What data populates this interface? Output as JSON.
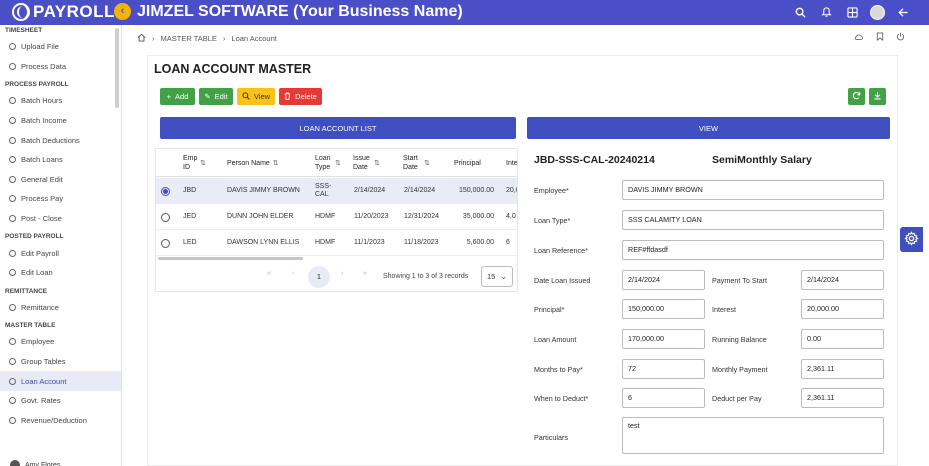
{
  "header": {
    "brand": "PAYROLL",
    "app_title": "JIMZEL SOFTWARE (Your Business Name)",
    "collapse_icon": "chevron-left-icon",
    "bg_color": "#4a4fc8"
  },
  "sidebar": {
    "sections": [
      {
        "label": "TIMESHEET",
        "items": [
          {
            "label": "Upload File"
          },
          {
            "label": "Process Data"
          }
        ]
      },
      {
        "label": "PROCESS PAYROLL",
        "items": [
          {
            "label": "Batch Hours"
          },
          {
            "label": "Batch Income"
          },
          {
            "label": "Batch Deductions"
          },
          {
            "label": "Batch Loans"
          },
          {
            "label": "General Edit"
          },
          {
            "label": "Process Pay"
          },
          {
            "label": "Post - Close"
          }
        ]
      },
      {
        "label": "POSTED PAYROLL",
        "items": [
          {
            "label": "Edit Payroll"
          },
          {
            "label": "Edit Loan"
          }
        ]
      },
      {
        "label": "REMITTANCE",
        "items": [
          {
            "label": "Remittance"
          }
        ]
      },
      {
        "label": "MASTER TABLE",
        "items": [
          {
            "label": "Employee"
          },
          {
            "label": "Group Tables"
          },
          {
            "label": "Loan Account"
          },
          {
            "label": "Govt. Rates"
          },
          {
            "label": "Revenue/Deduction"
          }
        ]
      }
    ],
    "active_item": "Loan Account",
    "user": "Amy Flores"
  },
  "breadcrumb": {
    "items": [
      "MASTER TABLE",
      "Loan Account"
    ]
  },
  "page_title": "LOAN ACCOUNT MASTER",
  "toolbar": {
    "add": "Add",
    "edit": "Edit",
    "view": "View",
    "delete": "Delete"
  },
  "list_bar": "LOAN ACCOUNT LIST",
  "view_bar": "VIEW",
  "table": {
    "columns": [
      "Emp ID",
      "Person Name",
      "Loan Type",
      "Issue Date",
      "Start Date",
      "Principal",
      "Inte"
    ],
    "rows": [
      {
        "selected": true,
        "emp_id": "JBD",
        "name": "DAVIS JIMMY BROWN",
        "loan_type": "SSS-CAL",
        "issue": "2/14/2024",
        "start": "2/14/2024",
        "principal": "150,000.00",
        "interest": "20,0"
      },
      {
        "selected": false,
        "emp_id": "JED",
        "name": "DUNN JOHN ELDER",
        "loan_type": "HDMF",
        "issue": "11/20/2023",
        "start": "12/31/2024",
        "principal": "35,000.00",
        "interest": "4,0"
      },
      {
        "selected": false,
        "emp_id": "LED",
        "name": "DAWSON LYNN ELLIS",
        "loan_type": "HDMF",
        "issue": "11/1/2023",
        "start": "11/18/2023",
        "principal": "5,600.00",
        "interest": "6"
      }
    ],
    "pager": {
      "first": "«",
      "prev": "‹",
      "page": "1",
      "next": "›",
      "last": "»",
      "info": "Showing 1 to 3 of 3 records",
      "page_size": "15"
    }
  },
  "form": {
    "title": "JBD-SSS-CAL-20240214",
    "subtitle": "SemiMonthly Salary",
    "employee_label": "Employee*",
    "employee": "DAVIS JIMMY BROWN",
    "loan_type_label": "Loan Type*",
    "loan_type": "SSS CALAMITY LOAN",
    "loan_ref_label": "Loan Reference*",
    "loan_ref": "REF#ffdasdf",
    "date_issued_label": "Date Loan Issued",
    "date_issued": "2/14/2024",
    "payment_start_label": "Payment To Start",
    "payment_start": "2/14/2024",
    "principal_label": "Principal*",
    "principal": "150,000.00",
    "interest_label": "Interest",
    "interest": "20,000.00",
    "loan_amount_label": "Loan Amount",
    "loan_amount": "170,000.00",
    "running_balance_label": "Running Balance",
    "running_balance": "0.00",
    "months_label": "Months to Pay*",
    "months": "72",
    "monthly_payment_label": "Monthly Payment",
    "monthly_payment": "2,361.11",
    "when_deduct_label": "When to Deduct*",
    "when_deduct": "6",
    "deduct_per_pay_label": "Deduct per Pay",
    "deduct_per_pay": "2,361.11",
    "particulars_label": "Particulars",
    "particulars": "test"
  }
}
